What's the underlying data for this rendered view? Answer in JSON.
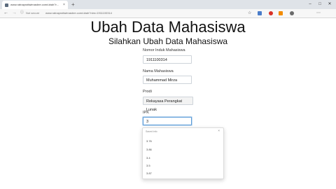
{
  "browser": {
    "tab_title": "www.ratnapratiwimasbre.com/ubah?r...",
    "tab_close": "×",
    "new_tab": "+",
    "address_status": "Not secure",
    "address_url": "www.ratnapratiwimasbre.com/ubah?nim=1911100314",
    "info_glyph": "ⓘ",
    "back": "←",
    "forward": "→",
    "reload": "↻",
    "star": "☆",
    "menu": "⋯",
    "minimize": "–",
    "maximize": "□",
    "close": "✕",
    "icon_colors": [
      "#4a7cc9",
      "#d93025",
      "#f28b00",
      "#6b6b6b"
    ]
  },
  "page": {
    "title": "Ubah Data Mahasiswa",
    "subtitle": "Silahkan Ubah Data Mahasiswa"
  },
  "form": {
    "nim_label": "Nomor Induk Mahasiswa",
    "nim_value": "1911100314",
    "nama_label": "Nama Mahasiswa",
    "nama_value": "Muhammad Mirza",
    "prodi_label": "Prodi",
    "prodi_value": "Rekayasa Perangkat Lunak",
    "ipk_label": "IPK",
    "ipk_value": "3"
  },
  "autocomplete": {
    "header": "Saved info",
    "close": "×",
    "items": [
      "3.76",
      "3.86",
      "3.4",
      "3.5",
      "3.87"
    ]
  }
}
